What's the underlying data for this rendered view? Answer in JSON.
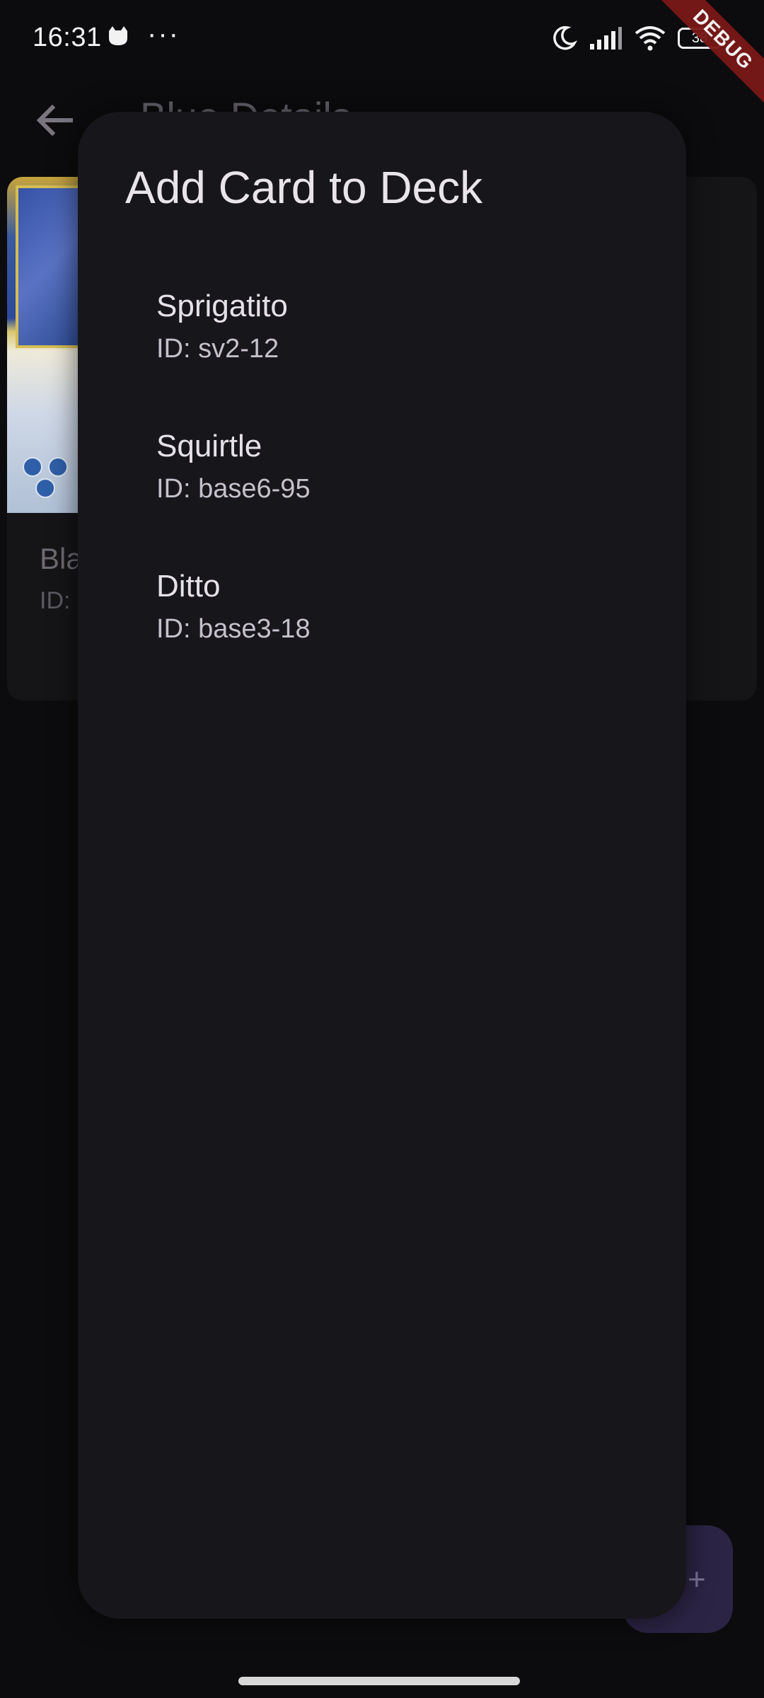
{
  "status_bar": {
    "time": "16:31",
    "notification_icon": "cat-face-icon",
    "more_indicator": "···",
    "icons": [
      "moon-icon",
      "signal-icon",
      "wifi-icon"
    ],
    "battery": "38",
    "debug_banner": "DEBUG"
  },
  "app_bar": {
    "back_icon": "arrow-left-icon",
    "title": "Blue Details"
  },
  "card": {
    "name": "Bla",
    "id_prefix": "ID:"
  },
  "fab": {
    "label": "+"
  },
  "dialog": {
    "title": "Add Card to Deck",
    "options": [
      {
        "name": "Sprigatito",
        "subtitle": "ID: sv2-12"
      },
      {
        "name": "Squirtle",
        "subtitle": "ID: base6-95"
      },
      {
        "name": "Ditto",
        "subtitle": "ID: base3-18"
      }
    ]
  },
  "colors": {
    "background": "#0c0c0e",
    "dialog_surface": "#17161b",
    "debug_banner": "#7a1818",
    "fab": "#2c2445"
  }
}
